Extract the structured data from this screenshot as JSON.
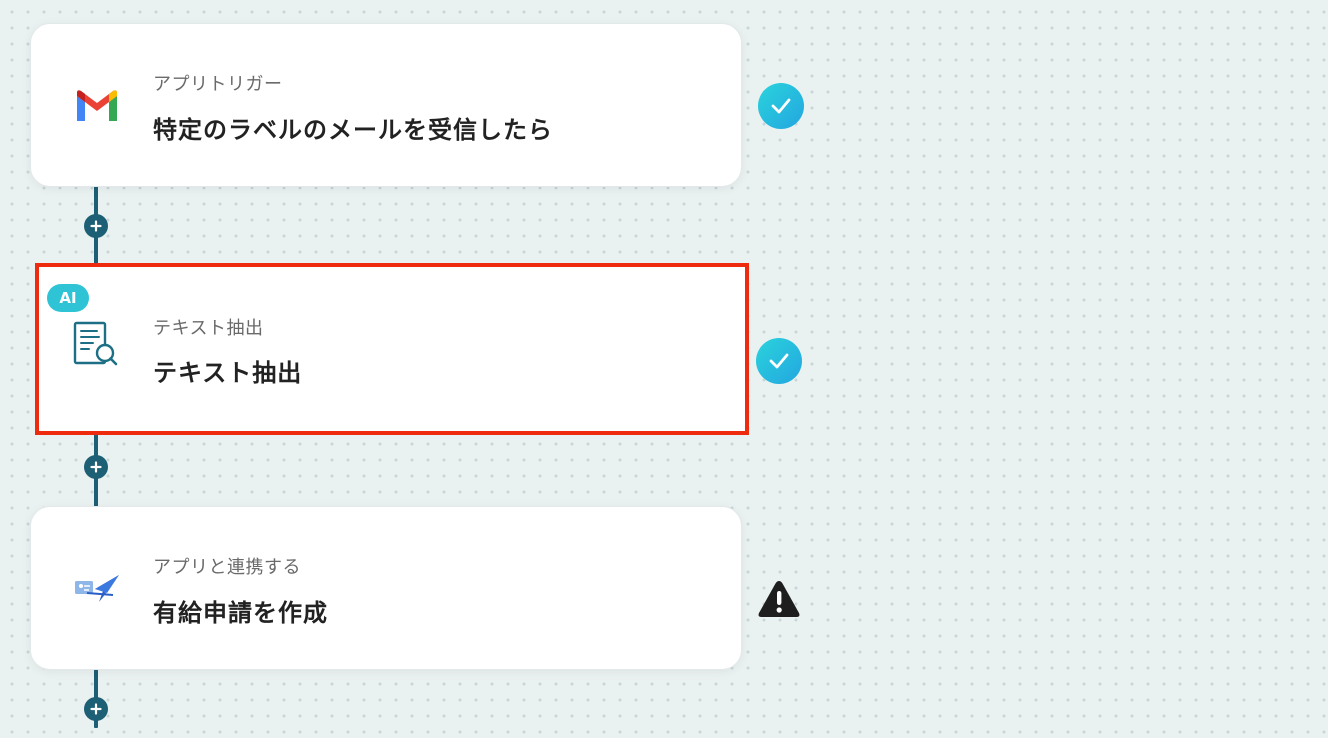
{
  "flow": {
    "steps": [
      {
        "type_label": "アプリトリガー",
        "title": "特定のラベルのメールを受信したら",
        "icon": "gmail-icon",
        "status": "complete"
      },
      {
        "badge": "AI",
        "type_label": "テキスト抽出",
        "title": "テキスト抽出",
        "icon": "document-search-icon",
        "status": "complete",
        "highlighted": true
      },
      {
        "type_label": "アプリと連携する",
        "title": "有給申請を作成",
        "icon": "app-airplane-icon",
        "status": "warning"
      }
    ]
  },
  "colors": {
    "connector": "#1d5f74",
    "highlight_border": "#ee2a0f",
    "check": "#2ec4d6",
    "ai_badge": "#2ec4d6"
  }
}
